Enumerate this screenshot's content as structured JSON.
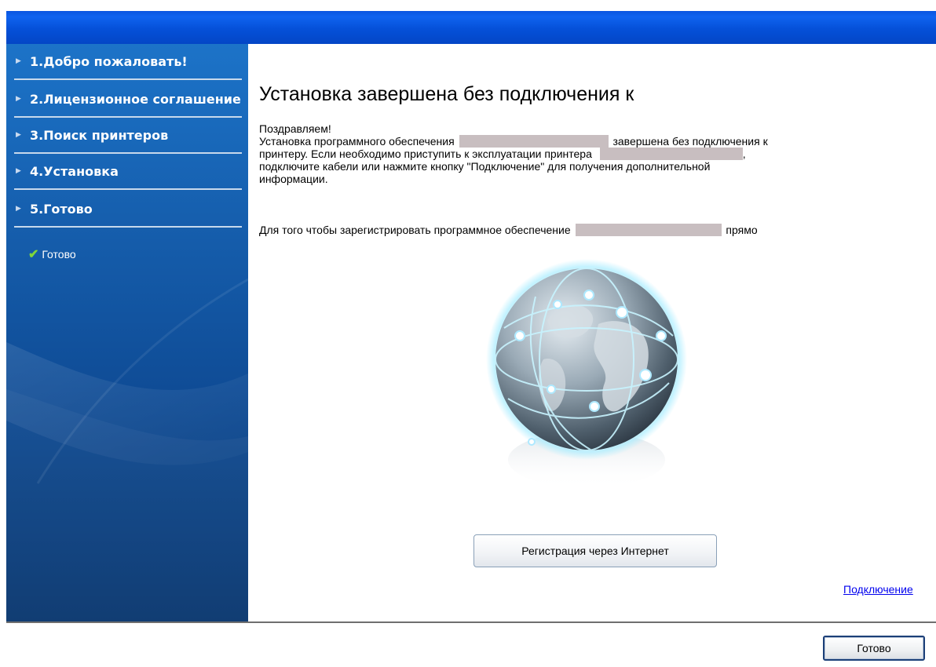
{
  "sidebar": {
    "steps": [
      {
        "label": "1.Добро пожаловать!"
      },
      {
        "label": "2.Лицензионное соглашение"
      },
      {
        "label": "3.Поиск принтеров"
      },
      {
        "label": "4.Установка"
      },
      {
        "label": "5.Готово"
      }
    ],
    "substep": {
      "label": "Готово",
      "icon": "checkmark-icon",
      "icon_color": "#7fd63a"
    }
  },
  "main": {
    "heading": "Установка завершена без подключения к",
    "para1": {
      "line1": "Поздравляем!",
      "line2_start": "Установка программного обеспечения",
      "line2_end": "завершена без подключения к",
      "line3_start": "принтеру. Если необходимо приступить к эксплуатации принтера",
      "line3_end": ",",
      "line4": "подключите кабели или нажмите кнопку \"Подключение\" для получения дополнительной",
      "line5": "информации."
    },
    "para2": {
      "start": "Для того чтобы зарегистрировать программное обеспечение",
      "end": "прямо"
    },
    "register_button": "Регистрация через Интернет",
    "connect_link": "Подключение"
  },
  "footer": {
    "done_button": "Готово"
  },
  "colors": {
    "titlebar": "#0550d8",
    "sidebar_top": "#1c73c8",
    "sidebar_bottom": "#08366e",
    "link": "#0000ee",
    "redaction": "#c8bec0"
  }
}
